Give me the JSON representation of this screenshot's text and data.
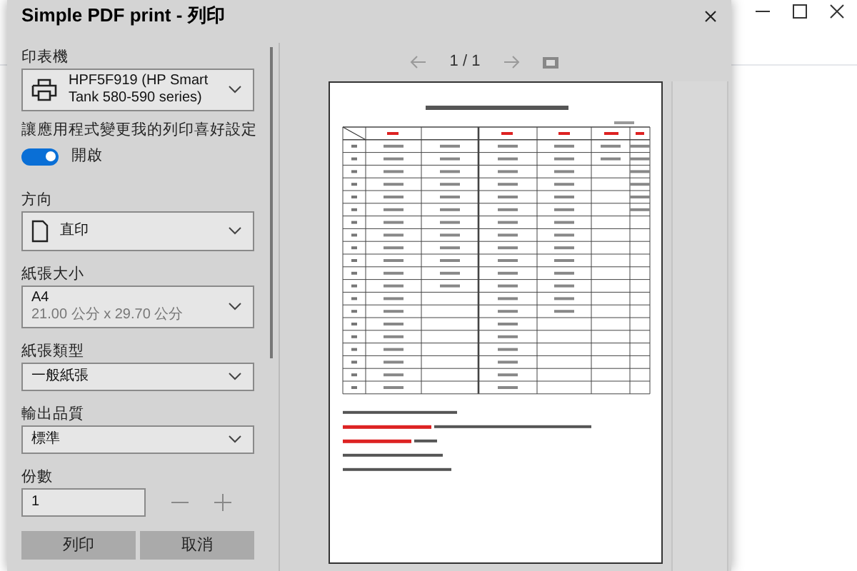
{
  "window": {
    "title": "Simple PDF print - 列印"
  },
  "settings": [
    {
      "kind": "dropdown",
      "label": "印表機",
      "value": "HPF5F919 (HP Smart Tank 580-590 series)"
    },
    {
      "kind": "toggle",
      "label": "讓應用程式變更我的列印喜好設定",
      "on": true,
      "state_text": "開啟"
    },
    {
      "kind": "dropdown",
      "label": "方向",
      "value": "直印"
    },
    {
      "kind": "dropdown",
      "label": "紙張大小",
      "value": "A4",
      "detail": "21.00 公分 x 29.70 公分"
    },
    {
      "kind": "dropdown",
      "label": "紙張類型",
      "value": "一般紙張"
    },
    {
      "kind": "dropdown",
      "label": "輸出品質",
      "value": "標準"
    },
    {
      "kind": "stepper",
      "label": "份數",
      "value": "1"
    }
  ],
  "preview": {
    "page_indicator": "1 / 1"
  },
  "buttons": [
    "列印",
    "取消"
  ]
}
